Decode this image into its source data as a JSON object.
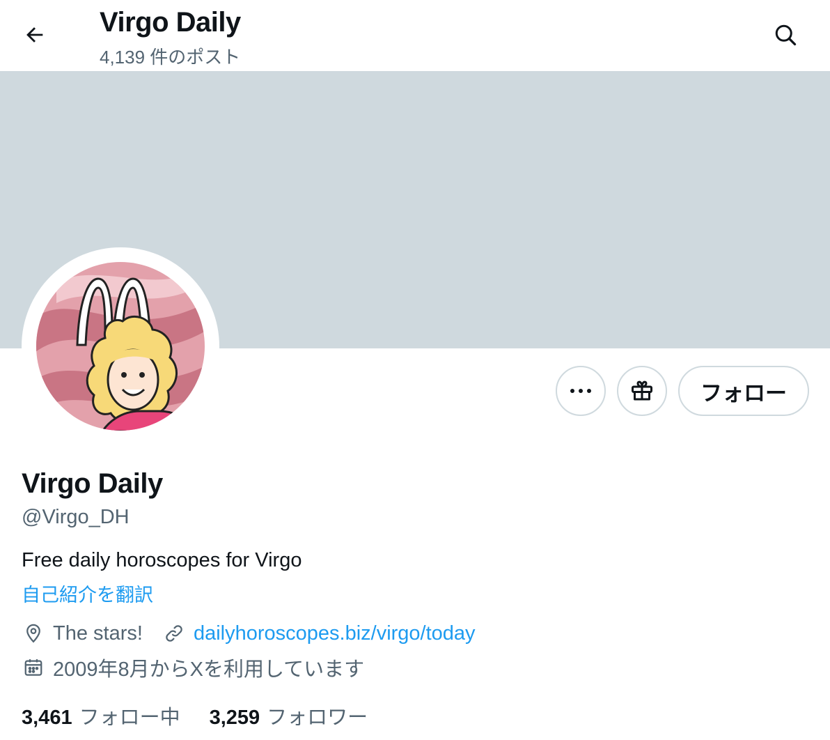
{
  "header": {
    "title": "Virgo Daily",
    "post_count": "4,139 件のポスト",
    "back_icon": "arrow-left-icon",
    "search_icon": "search-icon"
  },
  "colors": {
    "banner": "#cfd9de",
    "link": "#1d9bf0",
    "secondary_text": "#536471",
    "primary_text": "#0f1419"
  },
  "actions": {
    "more_icon": "more-icon",
    "gift_icon": "gift-icon",
    "follow_label": "フォロー"
  },
  "profile": {
    "name": "Virgo Daily",
    "handle": "@Virgo_DH",
    "bio": "Free daily horoscopes for Virgo",
    "translate_label": "自己紹介を翻訳",
    "location": "The stars!",
    "url": "dailyhoroscopes.biz/virgo/today",
    "joined": "2009年8月からXを利用しています"
  },
  "stats": {
    "following_count": "3,461",
    "following_label": "フォロー中",
    "followers_count": "3,259",
    "followers_label": "フォロワー"
  }
}
